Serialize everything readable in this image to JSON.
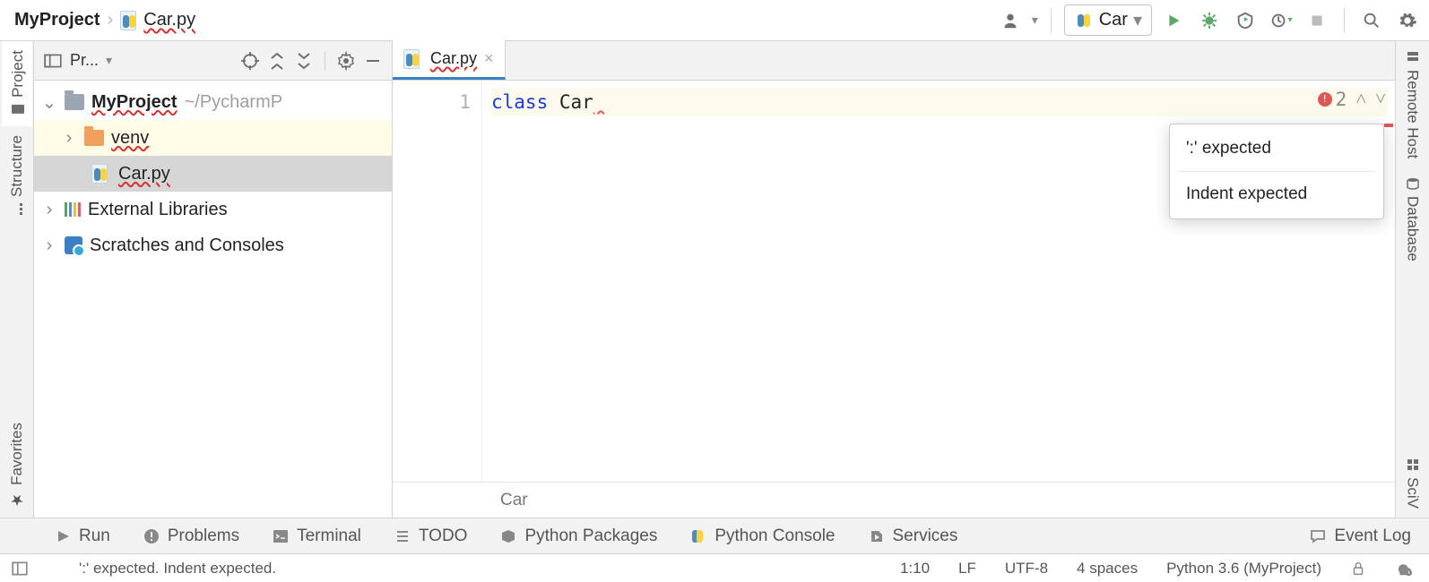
{
  "breadcrumb": {
    "project": "MyProject",
    "file": "Car.py"
  },
  "run_config": {
    "label": "Car"
  },
  "left_tabs": {
    "project": "Project",
    "structure": "Structure",
    "favorites": "Favorites"
  },
  "right_tabs": {
    "remote": "Remote Host",
    "database": "Database",
    "sciview": "SciV"
  },
  "project_panel": {
    "header": "Pr...",
    "root": {
      "name": "MyProject",
      "path": "~/PycharmP"
    },
    "venv": "venv",
    "file": "Car.py",
    "ext_lib": "External Libraries",
    "scratches": "Scratches and Consoles"
  },
  "editor": {
    "tab_label": "Car.py",
    "line_no": "1",
    "code_kw": "class",
    "code_ident": "Car",
    "breadcrumb_class": "Car",
    "error_count": "2",
    "popup": {
      "e1": "':' expected",
      "e2": "Indent expected"
    }
  },
  "bottom": {
    "run": "Run",
    "problems": "Problems",
    "terminal": "Terminal",
    "todo": "TODO",
    "packages": "Python Packages",
    "console": "Python Console",
    "services": "Services",
    "eventlog": "Event Log"
  },
  "status": {
    "message": "':' expected. Indent expected.",
    "pos": "1:10",
    "eol": "LF",
    "enc": "UTF-8",
    "indent": "4 spaces",
    "sdk": "Python 3.6 (MyProject)"
  }
}
